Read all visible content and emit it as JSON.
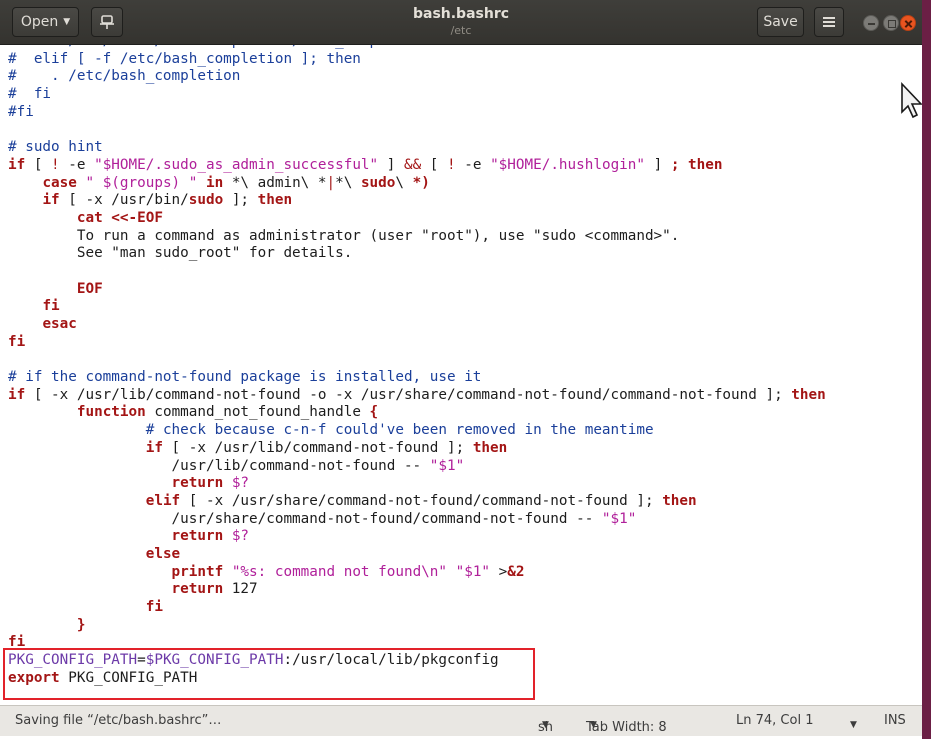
{
  "window": {
    "title": "bash.bashrc",
    "subtitle": "/etc",
    "open_label": "Open",
    "save_label": "Save"
  },
  "editor": {
    "lines": [
      [
        [
          "c",
          "#    . /usr/share/bash-completion/bash_completion"
        ]
      ],
      [
        [
          "c",
          "#  elif [ -f /etc/bash_completion ]; then"
        ]
      ],
      [
        [
          "c",
          "#    . /etc/bash_completion"
        ]
      ],
      [
        [
          "c",
          "#  fi"
        ]
      ],
      [
        [
          "c",
          "#fi"
        ]
      ],
      [
        [
          "t",
          ""
        ]
      ],
      [
        [
          "c",
          "# sudo hint"
        ]
      ],
      [
        [
          "k",
          "if"
        ],
        [
          "t",
          " [ "
        ],
        [
          "p",
          "!"
        ],
        [
          "t",
          " -e "
        ],
        [
          "s",
          "\"$HOME/.sudo_as_admin_successful\""
        ],
        [
          "t",
          " ] "
        ],
        [
          "p",
          "&&"
        ],
        [
          "t",
          " [ "
        ],
        [
          "p",
          "!"
        ],
        [
          "t",
          " -e "
        ],
        [
          "s",
          "\"$HOME/.hushlogin\""
        ],
        [
          "t",
          " ] "
        ],
        [
          "k",
          "; then"
        ]
      ],
      [
        [
          "t",
          "    "
        ],
        [
          "k",
          "case"
        ],
        [
          "t",
          " "
        ],
        [
          "s",
          "\" $(groups) \""
        ],
        [
          "t",
          " "
        ],
        [
          "k",
          "in"
        ],
        [
          "t",
          " *\\ admin\\ *"
        ],
        [
          "p",
          "|"
        ],
        [
          "t",
          "*\\ "
        ],
        [
          "k",
          "sudo"
        ],
        [
          "t",
          "\\ "
        ],
        [
          "k",
          "*)"
        ]
      ],
      [
        [
          "t",
          "    "
        ],
        [
          "k",
          "if"
        ],
        [
          "t",
          " [ -x /usr/bin/"
        ],
        [
          "k",
          "sudo"
        ],
        [
          "t",
          " ]; "
        ],
        [
          "k",
          "then"
        ]
      ],
      [
        [
          "t",
          "        "
        ],
        [
          "k",
          "cat <<-EOF"
        ]
      ],
      [
        [
          "t",
          "        To run a command as administrator (user \"root\"), use \"sudo <command>\"."
        ]
      ],
      [
        [
          "t",
          "        See \"man sudo_root\" for details."
        ]
      ],
      [
        [
          "t",
          ""
        ]
      ],
      [
        [
          "t",
          "        "
        ],
        [
          "k",
          "EOF"
        ]
      ],
      [
        [
          "t",
          "    "
        ],
        [
          "k",
          "fi"
        ]
      ],
      [
        [
          "t",
          "    "
        ],
        [
          "k",
          "esac"
        ]
      ],
      [
        [
          "k",
          "fi"
        ]
      ],
      [
        [
          "t",
          ""
        ]
      ],
      [
        [
          "c",
          "# if the command-not-found package is installed, use it"
        ]
      ],
      [
        [
          "k",
          "if"
        ],
        [
          "t",
          " [ -x /usr/lib/command-not-found -o -x /usr/share/command-not-found/command-not-found ]; "
        ],
        [
          "k",
          "then"
        ]
      ],
      [
        [
          "t",
          "        "
        ],
        [
          "k",
          "function"
        ],
        [
          "t",
          " command_not_found_handle "
        ],
        [
          "k",
          "{"
        ]
      ],
      [
        [
          "t",
          "                "
        ],
        [
          "c",
          "# check because c-n-f could've been removed in the meantime"
        ]
      ],
      [
        [
          "t",
          "                "
        ],
        [
          "k",
          "if"
        ],
        [
          "t",
          " [ -x /usr/lib/command-not-found ]; "
        ],
        [
          "k",
          "then"
        ]
      ],
      [
        [
          "t",
          "                   /usr/lib/command-not-found -- "
        ],
        [
          "s",
          "\"$1\""
        ]
      ],
      [
        [
          "t",
          "                   "
        ],
        [
          "k",
          "return"
        ],
        [
          "t",
          " "
        ],
        [
          "s",
          "$?"
        ]
      ],
      [
        [
          "t",
          "                "
        ],
        [
          "k",
          "elif"
        ],
        [
          "t",
          " [ -x /usr/share/command-not-found/command-not-found ]; "
        ],
        [
          "k",
          "then"
        ]
      ],
      [
        [
          "t",
          "                   /usr/share/command-not-found/command-not-found -- "
        ],
        [
          "s",
          "\"$1\""
        ]
      ],
      [
        [
          "t",
          "                   "
        ],
        [
          "k",
          "return"
        ],
        [
          "t",
          " "
        ],
        [
          "s",
          "$?"
        ]
      ],
      [
        [
          "t",
          "                "
        ],
        [
          "k",
          "else"
        ]
      ],
      [
        [
          "t",
          "                   "
        ],
        [
          "k",
          "printf"
        ],
        [
          "t",
          " "
        ],
        [
          "s",
          "\"%s: command not found\\n\""
        ],
        [
          "t",
          " "
        ],
        [
          "s",
          "\"$1\""
        ],
        [
          "t",
          " >"
        ],
        [
          "k",
          "&2"
        ]
      ],
      [
        [
          "t",
          "                   "
        ],
        [
          "k",
          "return"
        ],
        [
          "t",
          " 127"
        ]
      ],
      [
        [
          "t",
          "                "
        ],
        [
          "k",
          "fi"
        ]
      ],
      [
        [
          "t",
          "        "
        ],
        [
          "k",
          "}"
        ]
      ],
      [
        [
          "k",
          "fi"
        ]
      ],
      [
        [
          "v",
          "PKG_CONFIG_PATH"
        ],
        [
          "t",
          "="
        ],
        [
          "v",
          "$PKG_CONFIG_PATH"
        ],
        [
          "t",
          ":/usr/local/lib/pkgconfig"
        ]
      ],
      [
        [
          "k",
          "export"
        ],
        [
          "t",
          " PKG_CONFIG_PATH"
        ]
      ]
    ]
  },
  "status": {
    "message": "Saving file “/etc/bash.bashrc”…",
    "language": "sh",
    "tab_width": "Tab Width: 8",
    "position": "Ln 74, Col 1",
    "mode": "INS"
  },
  "icons": [
    "pin-icon",
    "hamburger-menu-icon",
    "minimize-icon",
    "maximize-icon",
    "close-icon",
    "mouse-pointer-icon"
  ],
  "colors": {
    "accent_close": "#e95420",
    "highlight": "#e2222a",
    "comment": "#1b3f9a",
    "keyword": "#a31515",
    "string": "#b0209a"
  }
}
